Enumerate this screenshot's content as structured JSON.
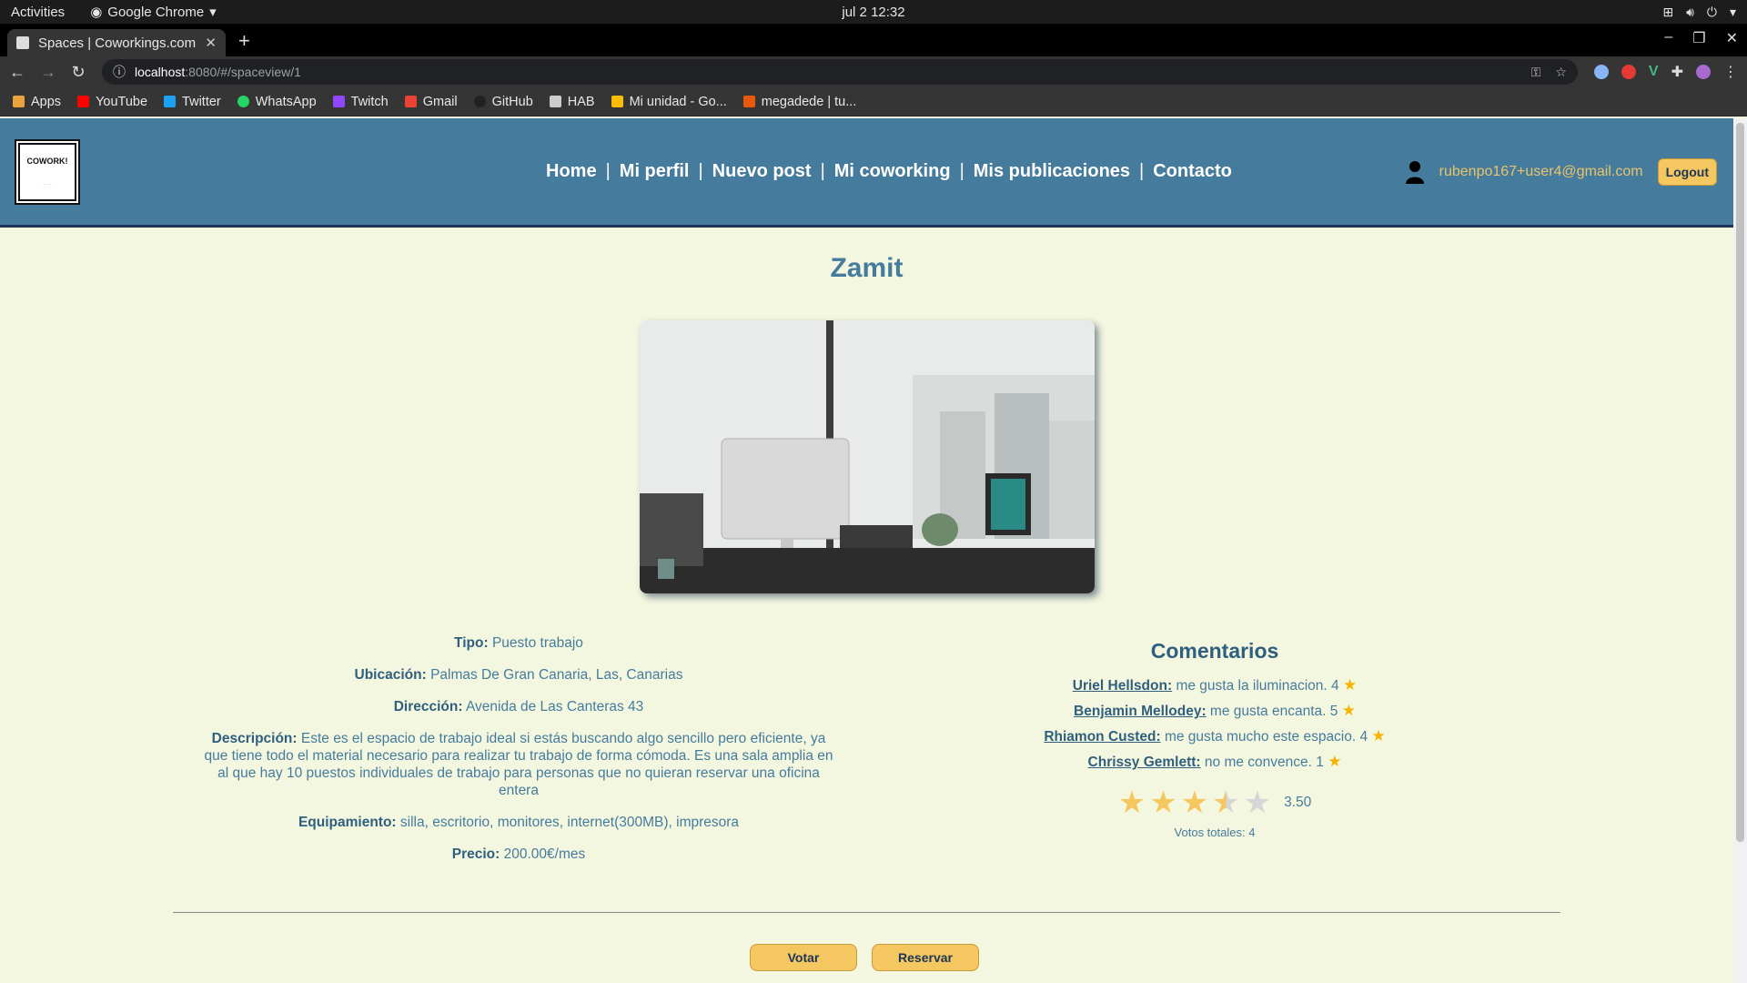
{
  "os": {
    "activities": "Activities",
    "app_name": "Google Chrome",
    "clock": "jul 2  12:32"
  },
  "browser": {
    "tab_title": "Spaces | Coworkings.com",
    "url_host": "localhost",
    "url_path": ":8080/#/spaceview/1",
    "bookmarks": [
      "Apps",
      "YouTube",
      "Twitter",
      "WhatsApp",
      "Twitch",
      "Gmail",
      "GitHub",
      "HAB",
      "Mi unidad - Go...",
      "megadede | tu..."
    ]
  },
  "site": {
    "logo_text": "COWORK!",
    "nav": [
      "Home",
      "Mi perfil",
      "Nuevo post",
      "Mi coworking",
      "Mis publicaciones",
      "Contacto"
    ],
    "user_email": "rubenpo167+user4@gmail.com",
    "logout_label": "Logout"
  },
  "space": {
    "name": "Zamit",
    "tipo_label": "Tipo:",
    "tipo": "Puesto trabajo",
    "ubicacion_label": "Ubicación:",
    "ubicacion": "Palmas De Gran Canaria, Las, Canarias",
    "direccion_label": "Dirección:",
    "direccion": "Avenida de Las Canteras 43",
    "descripcion_label": "Descripción:",
    "descripcion": "Este es el espacio de trabajo ideal si estás buscando algo sencillo pero eficiente, ya que tiene todo el material necesario para realizar tu trabajo de forma cómoda. Es una sala amplia en al que hay 10 puestos individuales de trabajo para personas que no quieran reservar una oficina entera",
    "equipamiento_label": "Equipamiento:",
    "equipamiento": "silla, escritorio, monitores, internet(300MB), impresora",
    "precio_label": "Precio:",
    "precio": "200.00€/mes"
  },
  "comments": {
    "title": "Comentarios",
    "items": [
      {
        "author": "Uriel Hellsdon:",
        "text": "me gusta la iluminacion. 4"
      },
      {
        "author": "Benjamin Mellodey:",
        "text": "me gusta encanta. 5"
      },
      {
        "author": "Rhiamon Custed:",
        "text": "me gusta mucho este espacio. 4"
      },
      {
        "author": "Chrissy Gemlett:",
        "text": "no me convence. 1"
      }
    ],
    "rating_value": "3.50",
    "rating_score": 3.5,
    "votes": "Votos totales: 4"
  },
  "actions": {
    "vote_label": "Votar",
    "reserve_label": "Reservar"
  },
  "colors": {
    "header": "#457b9d",
    "background": "#f4f7df",
    "accent": "#f4c761",
    "email": "#e9c46a"
  }
}
